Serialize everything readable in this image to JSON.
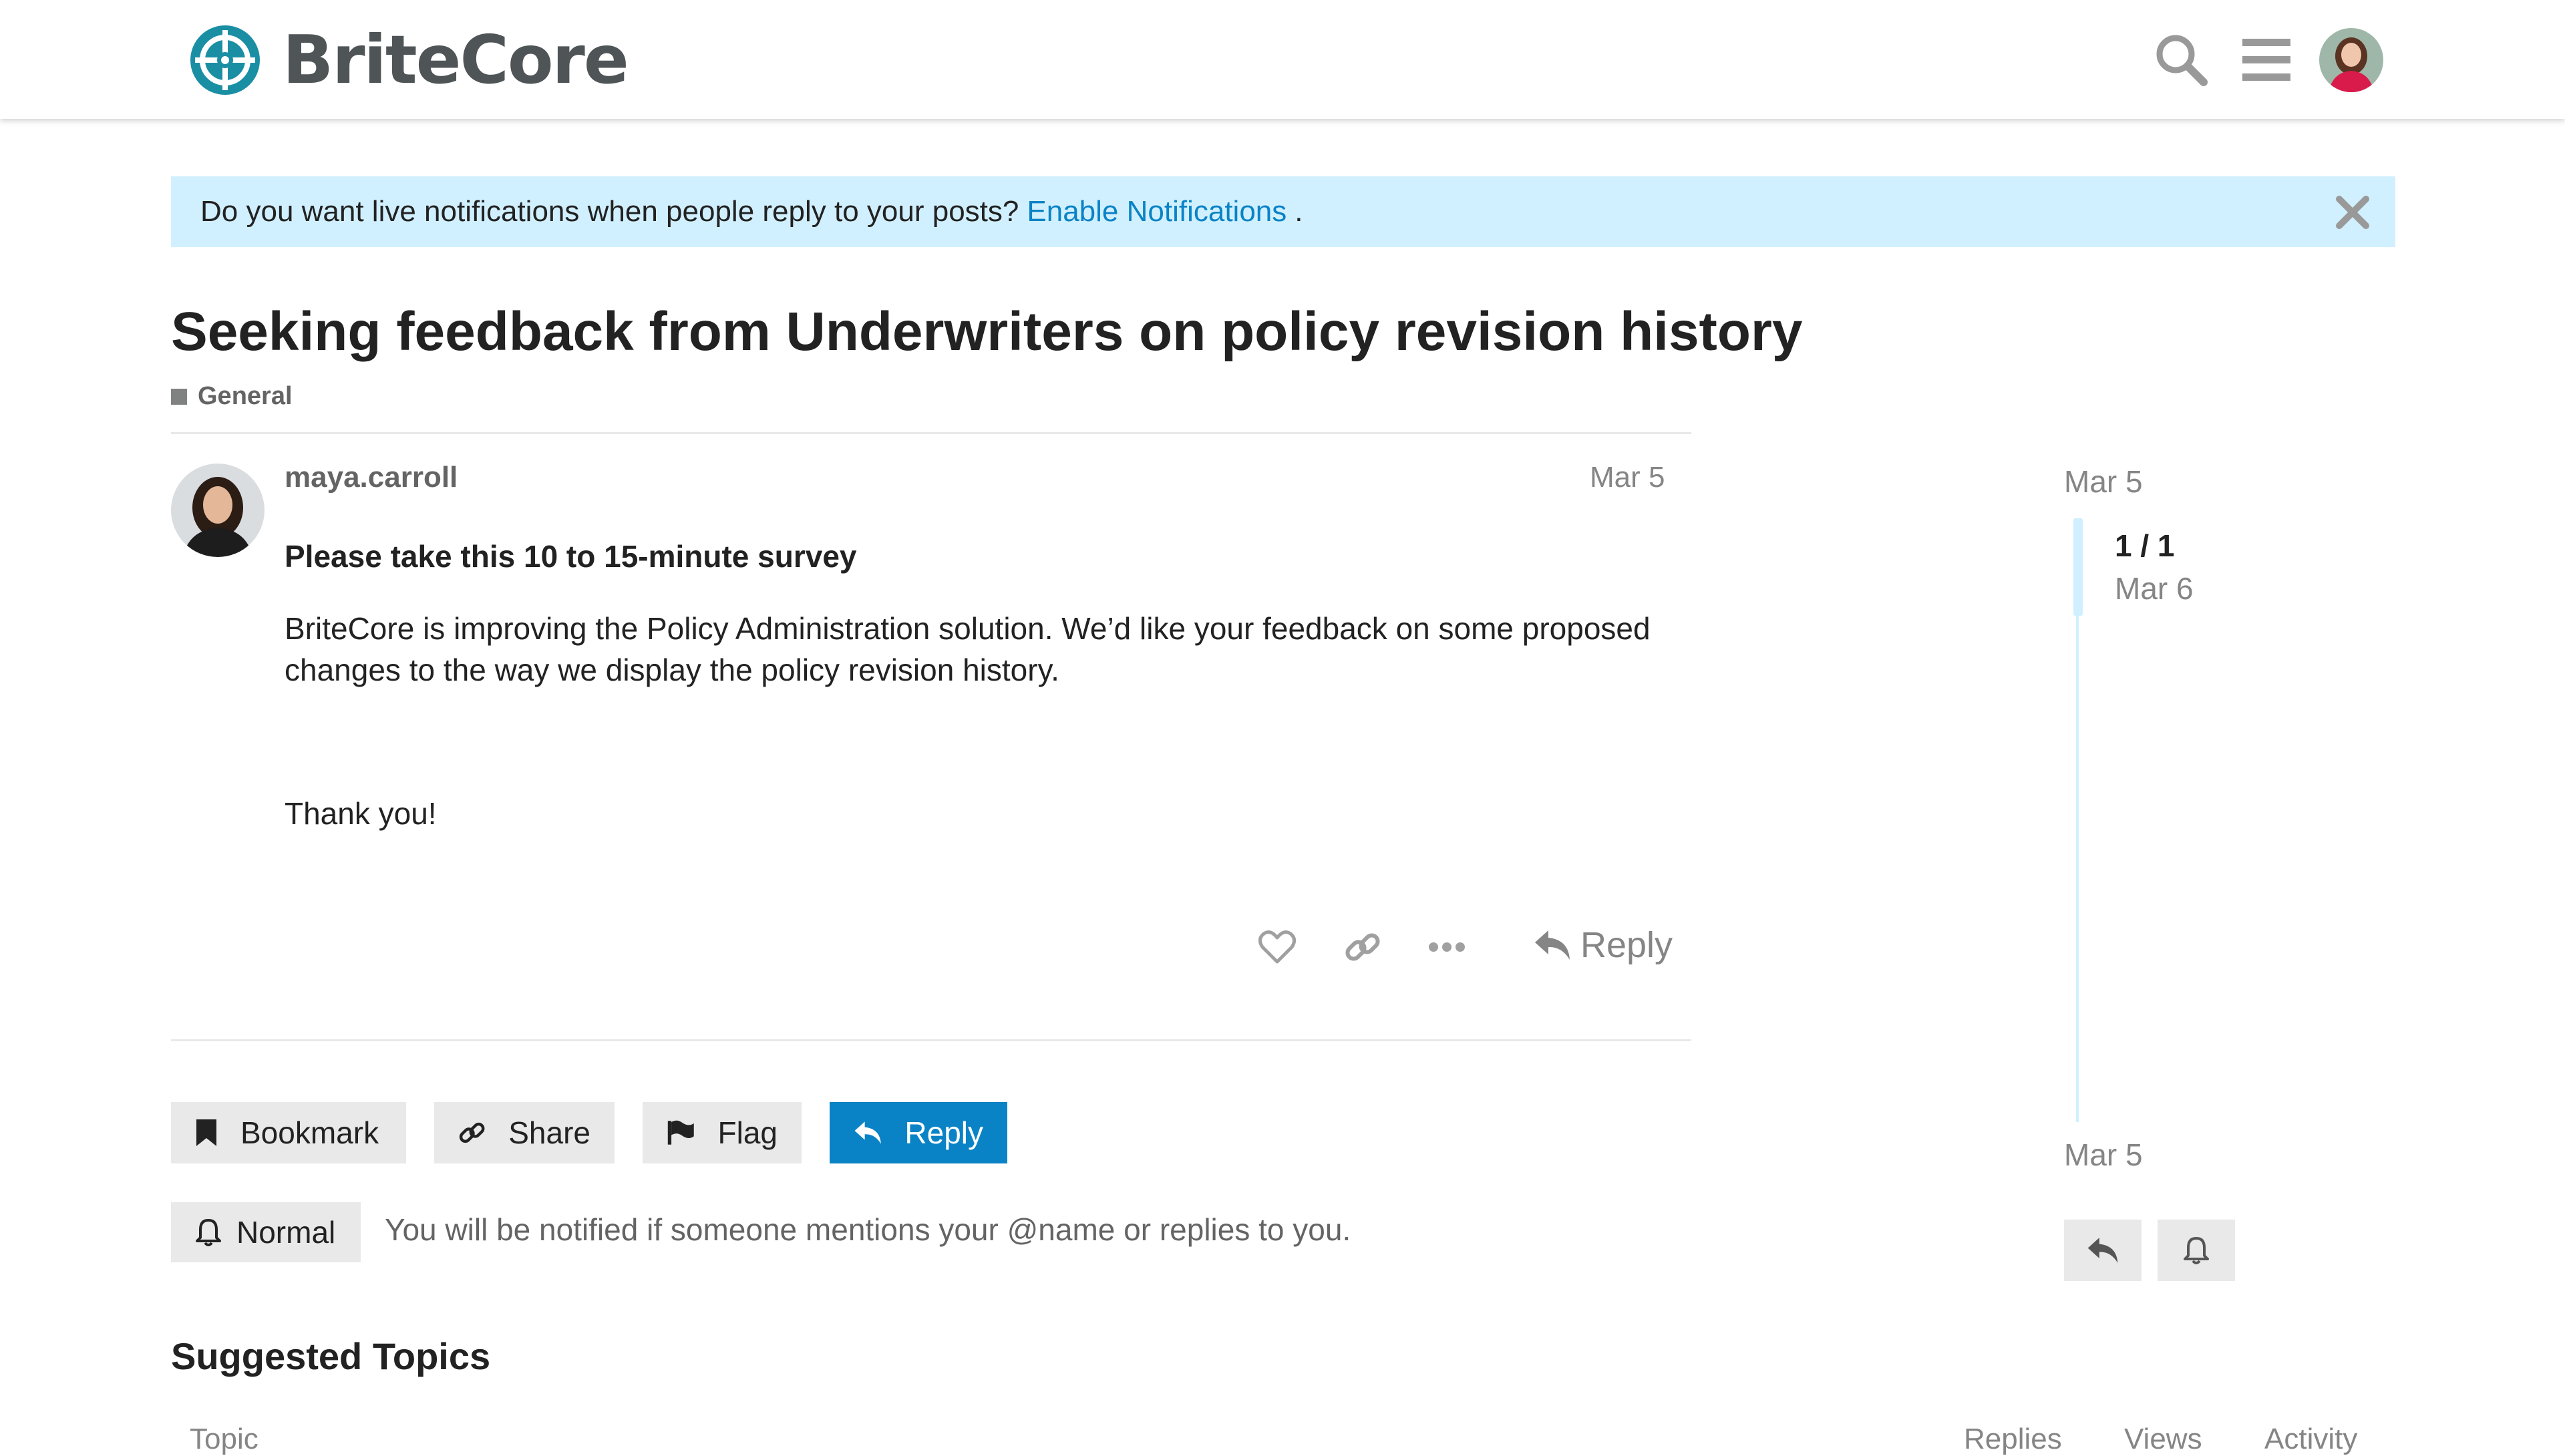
{
  "header": {
    "brand_name": "BriteCore",
    "icons": [
      "search-icon",
      "hamburger-menu-icon",
      "user-avatar"
    ]
  },
  "banner": {
    "text": "Do you want live notifications when people reply to your posts?",
    "link_label": "Enable Notifications",
    "suffix": "."
  },
  "topic": {
    "title": "Seeking feedback from Underwriters on policy revision history",
    "category": "General"
  },
  "post": {
    "author": "maya.carroll",
    "date": "Mar 5",
    "heading": "Please take this 10 to 15-minute survey",
    "paragraph_1": "BriteCore is improving the Policy Administration solution. We’d like your feedback on some proposed changes to the way we display the policy revision history.",
    "paragraph_2": "Thank you!",
    "reply_label": "Reply"
  },
  "footer_buttons": {
    "bookmark": "Bookmark",
    "share": "Share",
    "flag": "Flag",
    "reply": "Reply"
  },
  "notifications": {
    "level": "Normal",
    "description": "You will be notified if someone mentions your @name or replies to you."
  },
  "suggested": {
    "heading": "Suggested Topics",
    "columns": [
      "Topic",
      "Replies",
      "Views",
      "Activity"
    ]
  },
  "timeline": {
    "start_date": "Mar 5",
    "position": "1 / 1",
    "position_date": "Mar 6",
    "end_date": "Mar 5"
  },
  "colors": {
    "accent": "#0a83c6",
    "banner_bg": "#d1f0ff",
    "button_bg": "#e9e9e9",
    "brand_teal": "#1a8fa4"
  }
}
